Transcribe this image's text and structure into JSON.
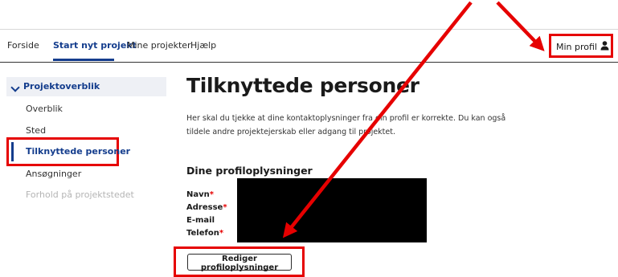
{
  "nav": {
    "items": [
      {
        "label": "Forside"
      },
      {
        "label": "Start nyt projekt",
        "active": true
      },
      {
        "label": "Mine projekter"
      },
      {
        "label": "Hjælp"
      }
    ],
    "profile_label": "Min profil",
    "profile_icon": "person-icon"
  },
  "sidebar": {
    "heading": "Projektoverblik",
    "items": [
      {
        "label": "Overblik"
      },
      {
        "label": "Sted"
      },
      {
        "label": "Tilknyttede personer",
        "active": true
      },
      {
        "label": "Ansøgninger"
      },
      {
        "label": "Forhold på projektstedet",
        "disabled": true
      }
    ]
  },
  "main": {
    "title": "Tilknyttede personer",
    "intro": "Her skal du tjekke at dine kontaktoplysninger fra din profil er korrekte. Du kan også tildele andre projektejerskab eller adgang til projektet.",
    "section_title": "Dine profiloplysninger",
    "fields": [
      {
        "label": "Navn",
        "required": "*"
      },
      {
        "label": "Adresse",
        "required": "*"
      },
      {
        "label": "E-mail",
        "required": ""
      },
      {
        "label": "Telefon",
        "required": "*"
      }
    ],
    "edit_button": "Rediger profiloplysninger"
  },
  "colors": {
    "accent": "#143d8d",
    "highlight": "#e60000",
    "required": "#e60000",
    "redaction": "#000000"
  }
}
